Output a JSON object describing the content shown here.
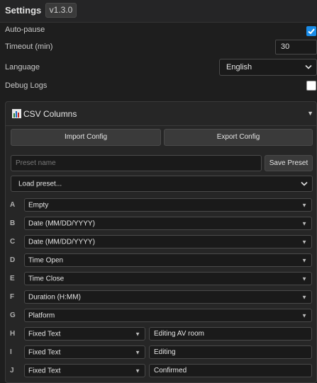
{
  "header": {
    "title": "Settings",
    "version": "v1.3.0"
  },
  "settings": {
    "auto_pause": {
      "label": "Auto-pause",
      "checked": true
    },
    "timeout": {
      "label": "Timeout (min)",
      "value": "30"
    },
    "language": {
      "label": "Language",
      "value": "English"
    },
    "debug_logs": {
      "label": "Debug Logs",
      "checked": false
    }
  },
  "csv": {
    "title": "CSV Columns",
    "toggle": "▼",
    "import_label": "Import Config",
    "export_label": "Export Config",
    "preset_placeholder": "Preset name",
    "save_preset_label": "Save Preset",
    "load_preset_label": "Load preset...",
    "columns": [
      {
        "letter": "A",
        "type": "Empty",
        "text": ""
      },
      {
        "letter": "B",
        "type": "Date (MM/DD/YYYY)",
        "text": ""
      },
      {
        "letter": "C",
        "type": "Date (MM/DD/YYYY)",
        "text": ""
      },
      {
        "letter": "D",
        "type": "Time Open",
        "text": ""
      },
      {
        "letter": "E",
        "type": "Time Close",
        "text": ""
      },
      {
        "letter": "F",
        "type": "Duration (H:MM)",
        "text": ""
      },
      {
        "letter": "G",
        "type": "Platform",
        "text": ""
      },
      {
        "letter": "H",
        "type": "Fixed Text",
        "text": "Editing AV room"
      },
      {
        "letter": "I",
        "type": "Fixed Text",
        "text": "Editing"
      },
      {
        "letter": "J",
        "type": "Fixed Text",
        "text": "Confirmed"
      }
    ]
  },
  "colors": {
    "accent": "#1a8ce8",
    "background": "#1e1e1e",
    "panel": "#262626"
  }
}
